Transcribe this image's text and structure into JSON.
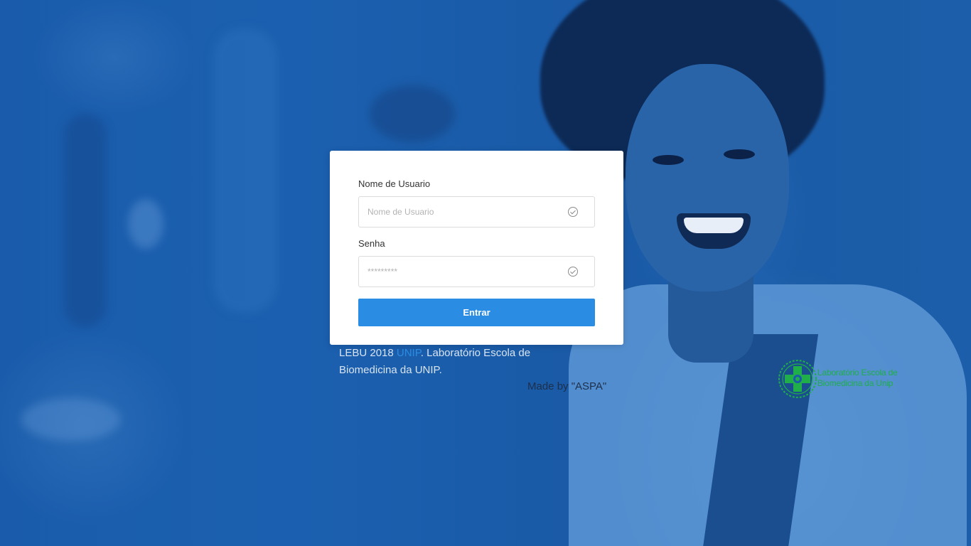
{
  "login": {
    "username_label": "Nome de Usuario",
    "username_placeholder": "Nome de Usuario",
    "password_label": "Senha",
    "password_placeholder": "*********",
    "submit_label": "Entrar"
  },
  "footer": {
    "prefix": "LEBU 2018 ",
    "unip_link": "UNIP",
    "suffix": ". Laboratório Escola de Biomedicina da UNIP.",
    "made_by": "Made by \"ASPA\""
  },
  "logo": {
    "line1": "Laboratório Escola de",
    "line2": "Biomedicina da Unip"
  },
  "colors": {
    "background": "#1a5cab",
    "button": "#2b8ce3",
    "link": "#2b8ce3",
    "logo_green": "#1fae4a"
  }
}
